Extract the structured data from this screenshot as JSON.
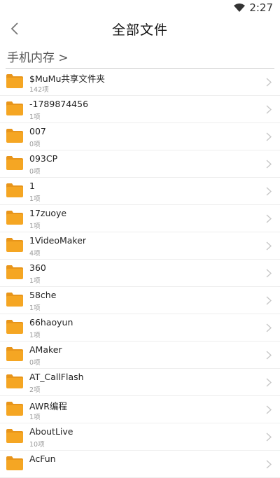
{
  "status": {
    "time": "2:27"
  },
  "header": {
    "title": "全部文件"
  },
  "breadcrumb": {
    "path": "手机内存 >"
  },
  "folders": [
    {
      "name": "$MuMu共享文件夹",
      "count": "142项"
    },
    {
      "name": "-1789874456",
      "count": "1项"
    },
    {
      "name": "007",
      "count": "0项"
    },
    {
      "name": "093CP",
      "count": "0项"
    },
    {
      "name": "1",
      "count": "1项"
    },
    {
      "name": "17zuoye",
      "count": "1项"
    },
    {
      "name": "1VideoMaker",
      "count": "4项"
    },
    {
      "name": "360",
      "count": "1项"
    },
    {
      "name": "58che",
      "count": "1项"
    },
    {
      "name": "66haoyun",
      "count": "1项"
    },
    {
      "name": "AMaker",
      "count": "0项"
    },
    {
      "name": "AT_CallFlash",
      "count": "2项"
    },
    {
      "name": "AWR编程",
      "count": "1项"
    },
    {
      "name": "AboutLive",
      "count": "10项"
    },
    {
      "name": "AcFun",
      "count": ""
    }
  ],
  "colors": {
    "folder": "#f5a623",
    "folder_tab": "#e8951a",
    "chevron": "#c8c8c8"
  }
}
